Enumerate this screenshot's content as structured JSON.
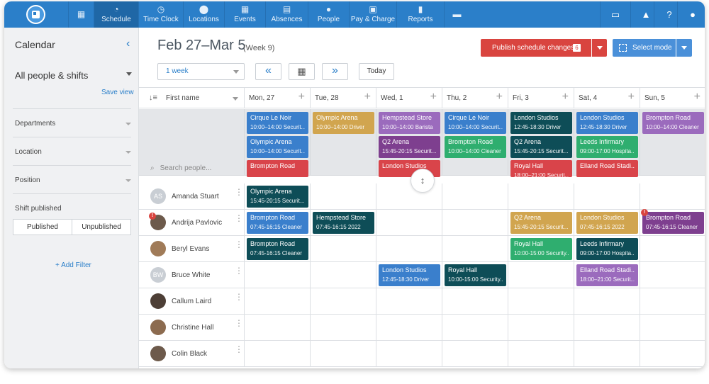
{
  "nav": {
    "items": [
      {
        "label": "Schedule",
        "icon": "schedule-icon",
        "glyph": "◔"
      },
      {
        "label": "Time Clock",
        "icon": "clock-icon",
        "glyph": "◷"
      },
      {
        "label": "Locations",
        "icon": "location-pin-icon",
        "glyph": "⬤"
      },
      {
        "label": "Events",
        "icon": "calendar-icon",
        "glyph": "▦"
      },
      {
        "label": "Absences",
        "icon": "absences-icon",
        "glyph": "▤"
      },
      {
        "label": "People",
        "icon": "people-icon",
        "glyph": "●"
      },
      {
        "label": "Pay & Charge",
        "icon": "pay-icon",
        "glyph": "▣"
      },
      {
        "label": "Reports",
        "icon": "reports-icon",
        "glyph": "▮"
      }
    ]
  },
  "sidebar": {
    "title": "Calendar",
    "people_filter": "All people & shifts",
    "save_view": "Save view",
    "filters": [
      "Departments",
      "Location",
      "Position"
    ],
    "shift_published_label": "Shift published",
    "published": "Published",
    "unpublished": "Unpublished",
    "add_filter": "+ Add Filter"
  },
  "header": {
    "title": "Feb 27–Mar 5",
    "week": "(Week 9)",
    "publish_label": "Publish schedule changes",
    "publish_count": "6",
    "select_mode": "Select mode",
    "view": "1 week",
    "today": "Today"
  },
  "grid": {
    "first_name_label": "First name",
    "search_placeholder": "Search people...",
    "days": [
      "Mon, 27",
      "Tue, 28",
      "Wed, 1",
      "Thu, 2",
      "Fri, 3",
      "Sat, 4",
      "Sun, 5"
    ],
    "open_shifts": [
      {
        "day": 0,
        "slot": 0,
        "title": "Cirque Le Noir",
        "detail": "10:00–14:00 Securit...",
        "color": "#3a7fcc"
      },
      {
        "day": 0,
        "slot": 1,
        "title": "Olympic Arena",
        "detail": "10:00–14:00 Securit...",
        "color": "#3a7fcc"
      },
      {
        "day": 0,
        "slot": 2,
        "title": "Brompton Road",
        "detail": "",
        "color": "#d9444a"
      },
      {
        "day": 1,
        "slot": 0,
        "title": "Olympic Arena",
        "detail": "10:00–14:00 Driver",
        "color": "#d1a54f"
      },
      {
        "day": 2,
        "slot": 0,
        "title": "Hempstead Store",
        "detail": "10:00–14:00 Barista",
        "color": "#9b6bbd"
      },
      {
        "day": 2,
        "slot": 1,
        "title": "Q2 Arena",
        "detail": "15:45-20:15 Securit...",
        "color": "#7e3f8f"
      },
      {
        "day": 2,
        "slot": 2,
        "title": "London Studios",
        "detail": "",
        "color": "#d9444a"
      },
      {
        "day": 3,
        "slot": 0,
        "title": "Cirque Le Noir",
        "detail": "10:00–14:00 Securit...",
        "color": "#3a7fcc"
      },
      {
        "day": 3,
        "slot": 1,
        "title": "Brompton Road",
        "detail": "10:00–14:00 Cleaner",
        "color": "#2fae6f"
      },
      {
        "day": 4,
        "slot": 0,
        "title": "London Studios",
        "detail": "12:45-18:30 Driver",
        "color": "#0e4d57"
      },
      {
        "day": 4,
        "slot": 1,
        "title": "Q2 Arena",
        "detail": "15:45-20:15 Securit...",
        "color": "#0e4d57"
      },
      {
        "day": 4,
        "slot": 2,
        "title": "Royal Hall",
        "detail": "18:00–21:00 Securit...",
        "color": "#d9444a"
      },
      {
        "day": 5,
        "slot": 0,
        "title": "London Studios",
        "detail": "12:45-18:30 Driver",
        "color": "#3a7fcc"
      },
      {
        "day": 5,
        "slot": 1,
        "title": "Leeds Infirmary",
        "detail": "09:00-17:00 Hospita...",
        "color": "#2fae6f"
      },
      {
        "day": 5,
        "slot": 2,
        "title": "Elland Road Stadi...",
        "detail": "",
        "color": "#d9444a"
      },
      {
        "day": 6,
        "slot": 0,
        "title": "Brompton Road",
        "detail": "10:00–14:00 Cleaner",
        "color": "#9b6bbd"
      }
    ],
    "people": [
      {
        "name": "Amanda Stuart",
        "initials": "AS",
        "photo": "",
        "alert": false
      },
      {
        "name": "Andrija Pavlovic",
        "initials": "",
        "photo": "photo",
        "alert": true
      },
      {
        "name": "Beryl Evans",
        "initials": "",
        "photo": "photo4",
        "alert": false
      },
      {
        "name": "Bruce White",
        "initials": "BW",
        "photo": "",
        "alert": false
      },
      {
        "name": "Callum Laird",
        "initials": "",
        "photo": "photo3",
        "alert": false
      },
      {
        "name": "Christine Hall",
        "initials": "",
        "photo": "photo2",
        "alert": false
      },
      {
        "name": "Colin Black",
        "initials": "",
        "photo": "photo",
        "alert": false
      }
    ],
    "shifts": [
      {
        "row": 0,
        "day": 0,
        "title": "Olympic Arena",
        "detail": "15:45-20:15 Securit...",
        "color": "#0e4d57"
      },
      {
        "row": 1,
        "day": 0,
        "title": "Brompton Road",
        "detail": "07:45-16:15 Cleaner",
        "color": "#3a7fcc"
      },
      {
        "row": 1,
        "day": 1,
        "title": "Hempstead Store",
        "detail": "07:45-16:15 2022",
        "color": "#0e4d57"
      },
      {
        "row": 1,
        "day": 4,
        "title": "Q2 Arena",
        "detail": "15:45-20:15 Securit...",
        "color": "#d1a54f"
      },
      {
        "row": 1,
        "day": 5,
        "title": "London Studios",
        "detail": "07:45-16:15 2022",
        "color": "#d1a54f"
      },
      {
        "row": 1,
        "day": 6,
        "title": "Brompton Road",
        "detail": "07:45-16:15 Cleaner",
        "color": "#7e3f8f",
        "alert": true
      },
      {
        "row": 2,
        "day": 0,
        "title": "Brompton Road",
        "detail": "07:45-16:15 Cleaner",
        "color": "#0e4d57"
      },
      {
        "row": 2,
        "day": 4,
        "title": "Royal Hall",
        "detail": "10:00-15:00 Security...",
        "color": "#2fae6f"
      },
      {
        "row": 2,
        "day": 5,
        "title": "Leeds Infirmary",
        "detail": "09:00-17:00 Hospita...",
        "color": "#0e4d57"
      },
      {
        "row": 3,
        "day": 2,
        "title": "London Studios",
        "detail": "12:45-18:30 Driver",
        "color": "#3a7fcc"
      },
      {
        "row": 3,
        "day": 3,
        "title": "Royal Hall",
        "detail": "10:00-15:00 Security...",
        "color": "#0e4d57"
      },
      {
        "row": 3,
        "day": 5,
        "title": "Elland Road Stadi...",
        "detail": "18:00–21:00 Securit...",
        "color": "#9b6bbd"
      }
    ]
  }
}
